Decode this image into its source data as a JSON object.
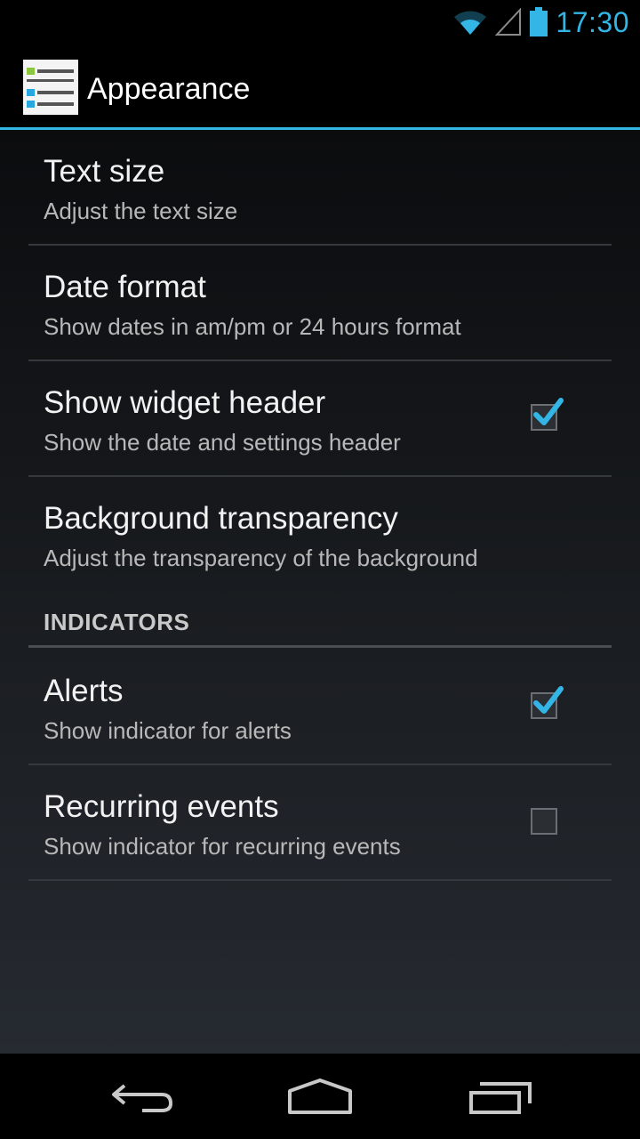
{
  "status_bar": {
    "time": "17:30",
    "icons": [
      "wifi-icon",
      "signal-icon",
      "battery-icon"
    ],
    "accent": "#33b5e5"
  },
  "action_bar": {
    "title": "Appearance",
    "icon": "settings-list-icon"
  },
  "preferences": [
    {
      "title": "Text size",
      "summary": "Adjust the text size"
    },
    {
      "title": "Date format",
      "summary": "Show dates in am/pm or 24 hours format"
    },
    {
      "title": "Show widget header",
      "summary": "Show the date and settings header",
      "checked": true
    },
    {
      "title": "Background transparency",
      "summary": "Adjust the transparency of the background"
    }
  ],
  "indicators": {
    "header": "INDICATORS",
    "items": [
      {
        "title": "Alerts",
        "summary": "Show indicator for alerts",
        "checked": true
      },
      {
        "title": "Recurring events",
        "summary": "Show indicator for recurring events",
        "checked": false
      }
    ]
  },
  "nav_bar": {
    "buttons": [
      "back-icon",
      "home-icon",
      "recent-apps-icon"
    ]
  }
}
